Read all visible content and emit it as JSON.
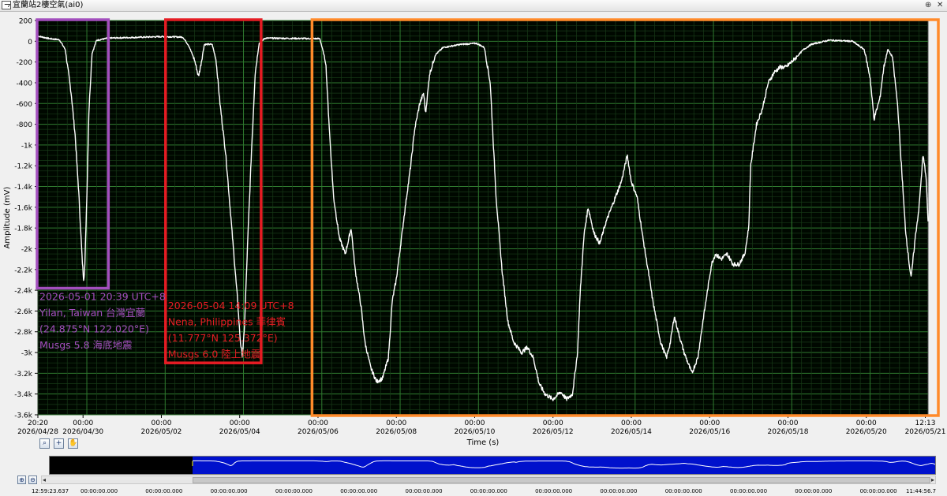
{
  "window": {
    "title": "宜蘭站2樓空氣(ai0)",
    "pin_glyph": "⊕",
    "close_glyph": "✕"
  },
  "chart_data": {
    "type": "line",
    "ylabel": "Amplitude (mV)",
    "xlabel": "Time (s)",
    "ylim": [
      -3600,
      200
    ],
    "xlim_days": [
      0,
      22.73
    ],
    "grid": true,
    "y_ticks": [
      {
        "v": 200,
        "label": "200"
      },
      {
        "v": 0,
        "label": "0"
      },
      {
        "v": -200,
        "label": "-200"
      },
      {
        "v": -400,
        "label": "-400"
      },
      {
        "v": -600,
        "label": "-600"
      },
      {
        "v": -800,
        "label": "-800"
      },
      {
        "v": -1000,
        "label": "-1k"
      },
      {
        "v": -1200,
        "label": "-1.2k"
      },
      {
        "v": -1400,
        "label": "-1.4k"
      },
      {
        "v": -1600,
        "label": "-1.6k"
      },
      {
        "v": -1800,
        "label": "-1.8k"
      },
      {
        "v": -2000,
        "label": "-2k"
      },
      {
        "v": -2200,
        "label": "-2.2k"
      },
      {
        "v": -2400,
        "label": "-2.4k"
      },
      {
        "v": -2600,
        "label": "-2.6k"
      },
      {
        "v": -2800,
        "label": "-2.8k"
      },
      {
        "v": -3000,
        "label": "-3k"
      },
      {
        "v": -3200,
        "label": "-3.2k"
      },
      {
        "v": -3400,
        "label": "-3.4k"
      },
      {
        "v": -3600,
        "label": "-3.6k"
      }
    ],
    "x_ticks": [
      {
        "d": 0,
        "time": "20:20",
        "date": "2026/04/28"
      },
      {
        "d": 1.153,
        "time": "00:00",
        "date": "2026/04/30"
      },
      {
        "d": 3.153,
        "time": "00:00",
        "date": "2026/05/02"
      },
      {
        "d": 5.153,
        "time": "00:00",
        "date": "2026/05/04"
      },
      {
        "d": 7.153,
        "time": "00:00",
        "date": "2026/05/06"
      },
      {
        "d": 9.153,
        "time": "00:00",
        "date": "2026/05/08"
      },
      {
        "d": 11.153,
        "time": "00:00",
        "date": "2026/05/10"
      },
      {
        "d": 13.153,
        "time": "00:00",
        "date": "2026/05/12"
      },
      {
        "d": 15.153,
        "time": "00:00",
        "date": "2026/05/14"
      },
      {
        "d": 17.153,
        "time": "00:00",
        "date": "2026/05/16"
      },
      {
        "d": 19.153,
        "time": "00:00",
        "date": "2026/05/18"
      },
      {
        "d": 21.153,
        "time": "00:00",
        "date": "2026/05/20"
      },
      {
        "d": 22.66,
        "time": "12:13",
        "date": "2026/05/21"
      }
    ],
    "series": [
      {
        "color": "#ffffff",
        "points": [
          [
            0,
            50
          ],
          [
            0.3,
            25
          ],
          [
            0.55,
            15
          ],
          [
            0.7,
            -80
          ],
          [
            0.85,
            -500
          ],
          [
            0.95,
            -900
          ],
          [
            1.05,
            -1500
          ],
          [
            1.13,
            -2100
          ],
          [
            1.17,
            -2300
          ],
          [
            1.2,
            -2150
          ],
          [
            1.25,
            -1500
          ],
          [
            1.3,
            -700
          ],
          [
            1.38,
            -120
          ],
          [
            1.5,
            10
          ],
          [
            1.8,
            30
          ],
          [
            3.2,
            45
          ],
          [
            3.7,
            40
          ],
          [
            3.85,
            -40
          ],
          [
            4.0,
            -180
          ],
          [
            4.1,
            -340
          ],
          [
            4.15,
            -250
          ],
          [
            4.25,
            -30
          ],
          [
            4.45,
            -30
          ],
          [
            4.55,
            -180
          ],
          [
            4.65,
            -600
          ],
          [
            4.8,
            -1100
          ],
          [
            4.95,
            -1800
          ],
          [
            5.1,
            -2500
          ],
          [
            5.17,
            -2900
          ],
          [
            5.22,
            -3030
          ],
          [
            5.27,
            -2800
          ],
          [
            5.35,
            -2000
          ],
          [
            5.45,
            -1100
          ],
          [
            5.55,
            -300
          ],
          [
            5.65,
            -20
          ],
          [
            5.8,
            30
          ],
          [
            7.2,
            25
          ],
          [
            7.35,
            -200
          ],
          [
            7.45,
            -900
          ],
          [
            7.55,
            -1500
          ],
          [
            7.7,
            -1900
          ],
          [
            7.85,
            -2050
          ],
          [
            8.0,
            -1800
          ],
          [
            8.1,
            -2200
          ],
          [
            8.25,
            -2550
          ],
          [
            8.35,
            -2900
          ],
          [
            8.5,
            -3150
          ],
          [
            8.65,
            -3280
          ],
          [
            8.8,
            -3250
          ],
          [
            8.95,
            -3050
          ],
          [
            9.05,
            -2500
          ],
          [
            9.15,
            -2300
          ],
          [
            9.25,
            -2000
          ],
          [
            9.38,
            -1600
          ],
          [
            9.52,
            -1200
          ],
          [
            9.62,
            -850
          ],
          [
            9.75,
            -600
          ],
          [
            9.85,
            -500
          ],
          [
            9.9,
            -700
          ],
          [
            10.0,
            -320
          ],
          [
            10.15,
            -130
          ],
          [
            10.35,
            -60
          ],
          [
            10.8,
            -30
          ],
          [
            11.2,
            -20
          ],
          [
            11.4,
            -60
          ],
          [
            11.55,
            -400
          ],
          [
            11.7,
            -1500
          ],
          [
            11.85,
            -2200
          ],
          [
            12.0,
            -2700
          ],
          [
            12.15,
            -2900
          ],
          [
            12.35,
            -3000
          ],
          [
            12.5,
            -2950
          ],
          [
            12.65,
            -3050
          ],
          [
            12.8,
            -3300
          ],
          [
            12.95,
            -3400
          ],
          [
            13.15,
            -3450
          ],
          [
            13.35,
            -3380
          ],
          [
            13.5,
            -3450
          ],
          [
            13.65,
            -3400
          ],
          [
            13.78,
            -3000
          ],
          [
            13.85,
            -2400
          ],
          [
            13.95,
            -1850
          ],
          [
            14.05,
            -1600
          ],
          [
            14.2,
            -1850
          ],
          [
            14.35,
            -1950
          ],
          [
            14.5,
            -1750
          ],
          [
            14.7,
            -1550
          ],
          [
            14.9,
            -1350
          ],
          [
            15.05,
            -1100
          ],
          [
            15.15,
            -1350
          ],
          [
            15.3,
            -1500
          ],
          [
            15.45,
            -1900
          ],
          [
            15.6,
            -2250
          ],
          [
            15.7,
            -2500
          ],
          [
            15.8,
            -2700
          ],
          [
            15.9,
            -2900
          ],
          [
            16.05,
            -3050
          ],
          [
            16.15,
            -2900
          ],
          [
            16.25,
            -2650
          ],
          [
            16.35,
            -2800
          ],
          [
            16.5,
            -3000
          ],
          [
            16.7,
            -3200
          ],
          [
            16.85,
            -3050
          ],
          [
            17.0,
            -2650
          ],
          [
            17.1,
            -2400
          ],
          [
            17.2,
            -2150
          ],
          [
            17.3,
            -2050
          ],
          [
            17.45,
            -2100
          ],
          [
            17.6,
            -2050
          ],
          [
            17.75,
            -2150
          ],
          [
            17.9,
            -2150
          ],
          [
            18.05,
            -2050
          ],
          [
            18.15,
            -1800
          ],
          [
            18.2,
            -1200
          ],
          [
            18.35,
            -800
          ],
          [
            18.5,
            -650
          ],
          [
            18.65,
            -400
          ],
          [
            18.8,
            -300
          ],
          [
            18.95,
            -250
          ],
          [
            19.1,
            -250
          ],
          [
            19.3,
            -180
          ],
          [
            19.55,
            -80
          ],
          [
            19.75,
            -30
          ],
          [
            20.2,
            10
          ],
          [
            20.8,
            0
          ],
          [
            21.1,
            -80
          ],
          [
            21.25,
            -350
          ],
          [
            21.35,
            -750
          ],
          [
            21.5,
            -550
          ],
          [
            21.6,
            -250
          ],
          [
            21.7,
            -80
          ],
          [
            21.82,
            -150
          ],
          [
            21.95,
            -600
          ],
          [
            22.05,
            -1200
          ],
          [
            22.15,
            -1800
          ],
          [
            22.25,
            -2150
          ],
          [
            22.3,
            -2280
          ],
          [
            22.4,
            -1900
          ],
          [
            22.5,
            -1600
          ],
          [
            22.6,
            -1100
          ],
          [
            22.68,
            -1300
          ],
          [
            22.73,
            -1750
          ]
        ]
      }
    ],
    "zones": [
      {
        "key": "purple",
        "color": "#a34fbe",
        "d0": -0.02,
        "d1": 1.8,
        "v_bottom": -2380
      },
      {
        "key": "red",
        "color": "#e51c23",
        "d0": 3.26,
        "d1": 5.7,
        "v_bottom": -3100
      },
      {
        "key": "orange",
        "color": "#ff8a2a",
        "d0": 7.0,
        "d1": 23.0,
        "v_bottom": -3600
      }
    ],
    "annotations": [
      {
        "key": "purple",
        "color": "#a34fbe",
        "lines": [
          "2026-05-01 20:39 UTC+8",
          "Yilan, Taiwan 台灣宜蘭",
          "(24.875°N 122.020°E)",
          "Musgs 5.8 海底地震"
        ]
      },
      {
        "key": "red",
        "color": "#e51c23",
        "lines": [
          "2026-05-04 14:09 UTC+8",
          "Nena, Philippines 菲律賓",
          "(11.777°N 125.372°E)",
          "Musgs 6.0 陸上地震"
        ]
      }
    ]
  },
  "toolbar": {
    "zoom_icon": "⌕",
    "cursor_icon": "+",
    "pan_icon": "✋"
  },
  "navigator": {
    "zoom_in_icon": "⊕",
    "zoom_out_icon": "⊖",
    "scroll_left": "◂",
    "scroll_right": "▸"
  },
  "bottom_times": [
    "12:59:23.637",
    "00:00:00.000",
    "00:00:00.000",
    "00:00:00.000",
    "00:00:00.000",
    "00:00:00.000",
    "00:00:00.000",
    "00:00:00.000",
    "00:00:00.000",
    "00:00:00.000",
    "00:00:00.000",
    "00:00:00.000",
    "00:00:00.000",
    "00:00:00.000",
    "11:44:56.7"
  ]
}
